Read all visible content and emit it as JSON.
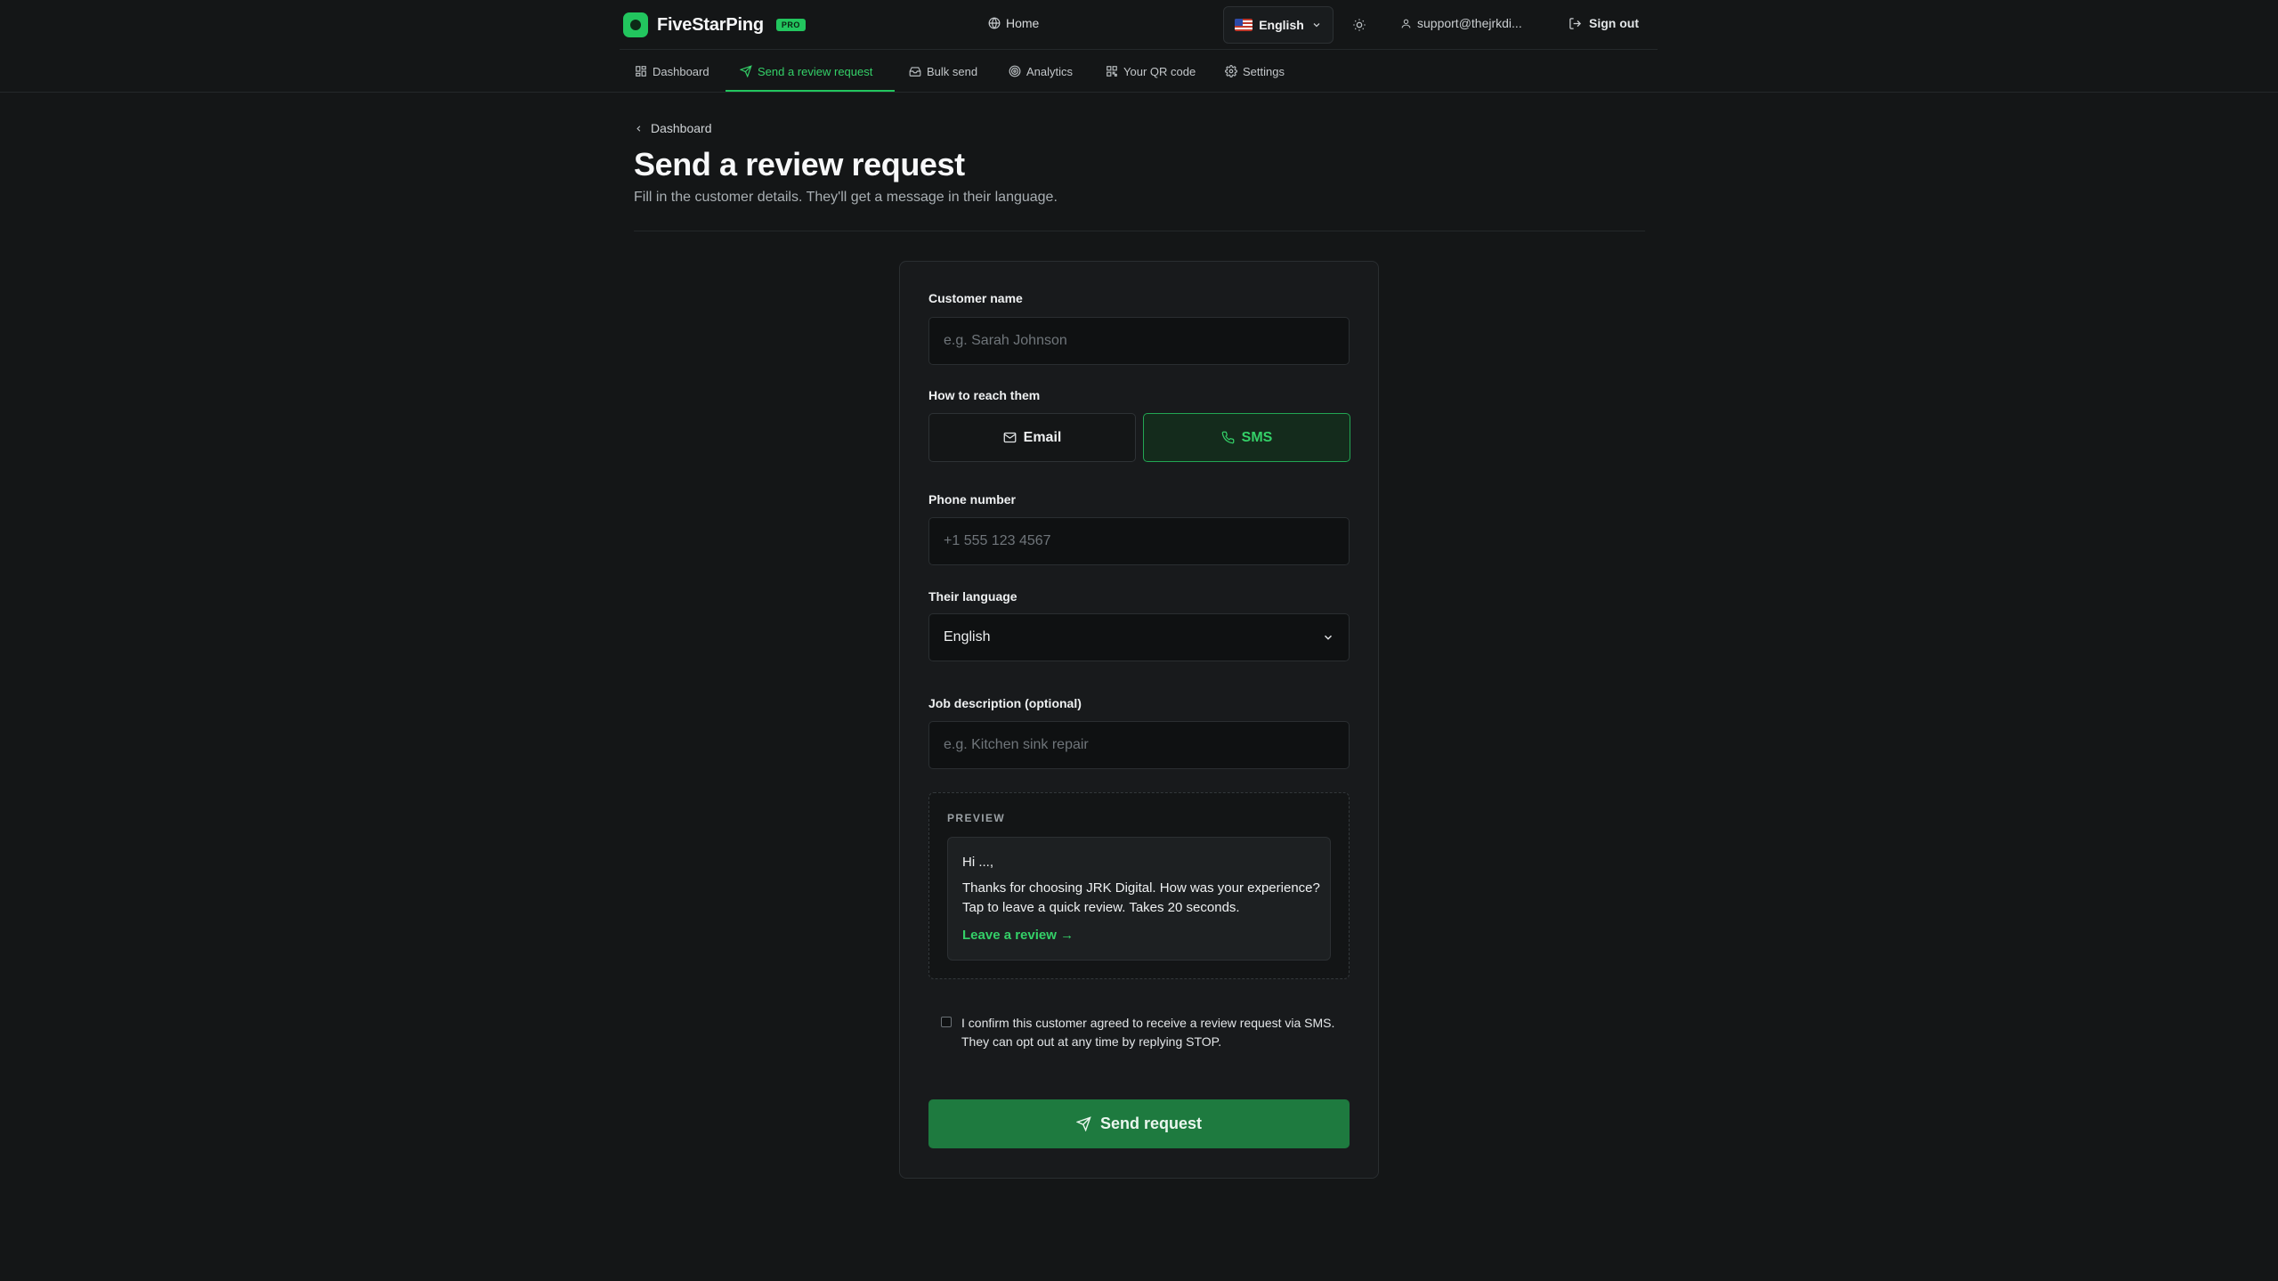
{
  "app": {
    "name": "FiveStarPing",
    "badge": "PRO",
    "brand_color": "#22c55e"
  },
  "header": {
    "home_label": "Home",
    "language_label": "English",
    "user_email": "support@thejrkdi...",
    "sign_out_label": "Sign out"
  },
  "nav": {
    "tabs": [
      {
        "label": "Dashboard",
        "icon": "grid-icon"
      },
      {
        "label": "Send a review request",
        "icon": "send-icon",
        "active": true
      },
      {
        "label": "Bulk send",
        "icon": "inbox-icon"
      },
      {
        "label": "Analytics",
        "icon": "target-icon"
      },
      {
        "label": "Your QR code",
        "icon": "qr-code-icon"
      },
      {
        "label": "Settings",
        "icon": "gear-icon"
      }
    ]
  },
  "page": {
    "breadcrumb": "Dashboard",
    "title": "Send a review request",
    "subtitle": "Fill in the customer details. They'll get a message in their language."
  },
  "form": {
    "customer_name": {
      "label": "Customer name",
      "value": "",
      "placeholder": "e.g. Sarah Johnson"
    },
    "reach": {
      "label": "How to reach them",
      "email_label": "Email",
      "sms_label": "SMS",
      "selected": "SMS"
    },
    "phone": {
      "label": "Phone number",
      "value": "",
      "placeholder": "+1 555 123 4567"
    },
    "language": {
      "label": "Their language",
      "value": "English"
    },
    "job": {
      "label": "Job description (optional)",
      "value": "",
      "placeholder": "e.g. Kitchen sink repair"
    },
    "preview": {
      "label": "PREVIEW",
      "greeting": "Hi ...,",
      "body": "Thanks for choosing JRK Digital. How was your experience? Tap to leave a quick review. Takes 20 seconds.",
      "link": "Leave a review →"
    },
    "consent": {
      "text": "I confirm this customer agreed to receive a review request via SMS. They can opt out at any time by replying STOP.",
      "checked": false
    },
    "submit_label": "Send request"
  }
}
